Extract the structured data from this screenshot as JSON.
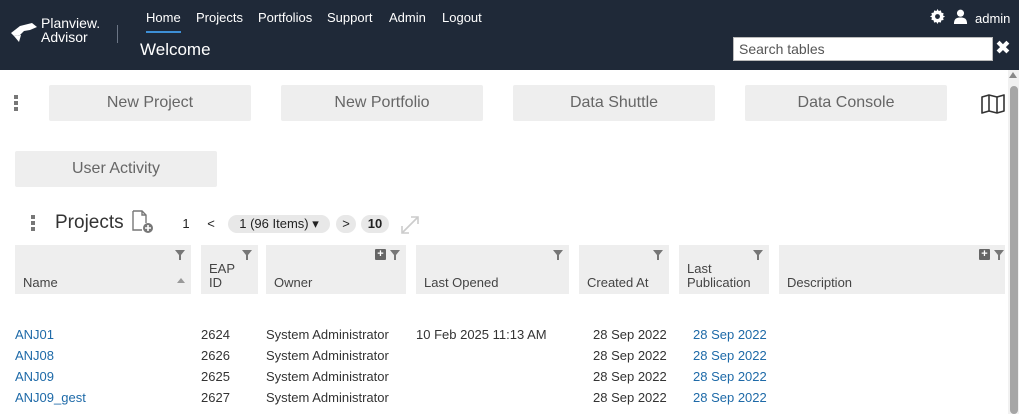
{
  "header": {
    "logo_line1": "Planview.",
    "logo_line2": "Advisor",
    "nav": [
      {
        "label": "Home",
        "active": true
      },
      {
        "label": "Projects"
      },
      {
        "label": "Portfolios"
      },
      {
        "label": "Support"
      },
      {
        "label": "Admin"
      },
      {
        "label": "Logout"
      }
    ],
    "page_title": "Welcome",
    "user_label": "admin",
    "search_placeholder": "Search tables",
    "search_value": ""
  },
  "actions": {
    "new_project": "New Project",
    "new_portfolio": "New Portfolio",
    "data_shuttle": "Data Shuttle",
    "data_console": "Data Console",
    "user_activity": "User Activity"
  },
  "projects": {
    "title": "Projects",
    "pager": {
      "first_page": "1",
      "prev": "<",
      "current": "1 (96 Items) ▾",
      "next": ">",
      "page_size": "10"
    },
    "columns": [
      "Name",
      "EAP ID",
      "Owner",
      "Last Opened",
      "Created At",
      "Last Publication",
      "Description"
    ],
    "rows": [
      {
        "name": "ANJ01",
        "eap_id": "2624",
        "owner": "System Administrator",
        "last_opened": "10 Feb 2025 11:13 AM",
        "created_at": "28 Sep 2022",
        "last_publication": "28 Sep 2022",
        "description": ""
      },
      {
        "name": "ANJ08",
        "eap_id": "2626",
        "owner": "System Administrator",
        "last_opened": "",
        "created_at": "28 Sep 2022",
        "last_publication": "28 Sep 2022",
        "description": ""
      },
      {
        "name": "ANJ09",
        "eap_id": "2625",
        "owner": "System Administrator",
        "last_opened": "",
        "created_at": "28 Sep 2022",
        "last_publication": "28 Sep 2022",
        "description": ""
      },
      {
        "name": "ANJ09_gest",
        "eap_id": "2627",
        "owner": "System Administrator",
        "last_opened": "",
        "created_at": "28 Sep 2022",
        "last_publication": "28 Sep 2022",
        "description": ""
      }
    ]
  },
  "colors": {
    "header_bg": "#1f2938",
    "accent": "#3d8fd6",
    "link": "#1e6aa8",
    "button_bg": "#eeeeee"
  },
  "icons": [
    "logo-bird-icon",
    "gear-icon",
    "user-icon",
    "close-icon",
    "kebab-icon",
    "map-icon",
    "new-file-icon",
    "expand-icon",
    "filter-icon",
    "plus-icon",
    "sort-icon"
  ]
}
